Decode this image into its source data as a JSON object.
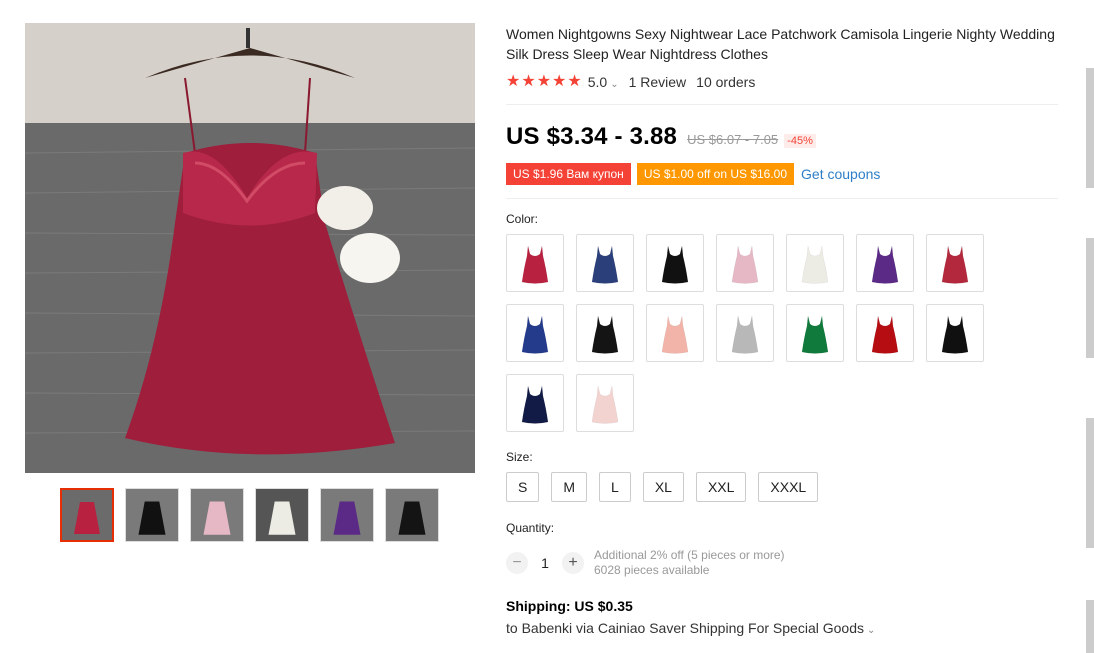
{
  "product": {
    "title": "Women Nightgowns Sexy Nightwear Lace Patchwork Camisola Lingerie Nighty Wedding Silk Dress Sleep Wear Nightdress Clothes",
    "rating": "5.0",
    "reviews": "1 Review",
    "orders": "10 orders",
    "star_color": "#f44336"
  },
  "price": {
    "current": "US $3.34 - 3.88",
    "original": "US $6.07 - 7.05",
    "discount": "-45%"
  },
  "coupons": {
    "coupon_1": "US $1.96 Вам купон",
    "coupon_2": "US $1.00 off on US $16.00",
    "get_link": "Get coupons"
  },
  "color": {
    "label": "Color:",
    "swatches": [
      "#b8213f",
      "#2b3f7a",
      "#111111",
      "#e6b8c6",
      "#ecebe4",
      "#5a2a86",
      "#b3283c",
      "#243b8c",
      "#141414",
      "#f2b4a8",
      "#b8b8b8",
      "#0f7a3b",
      "#b50d12",
      "#101010",
      "#121b45",
      "#f3d3d0"
    ]
  },
  "size": {
    "label": "Size:",
    "options": [
      "S",
      "M",
      "L",
      "XL",
      "XXL",
      "XXXL"
    ]
  },
  "quantity": {
    "label": "Quantity:",
    "minus": "−",
    "value": "1",
    "plus": "+",
    "info_line1": "Additional 2% off (5 pieces or more)",
    "info_line2": "6028 pieces available"
  },
  "shipping": {
    "title": "Shipping: US $0.35",
    "detail": "to Babenki via Cainiao Saver Shipping For Special Goods"
  },
  "thumbnails": [
    "#b8213f",
    "#111111",
    "#e6b8c6",
    "#ecebe4",
    "#5a2a86",
    "#141414"
  ]
}
